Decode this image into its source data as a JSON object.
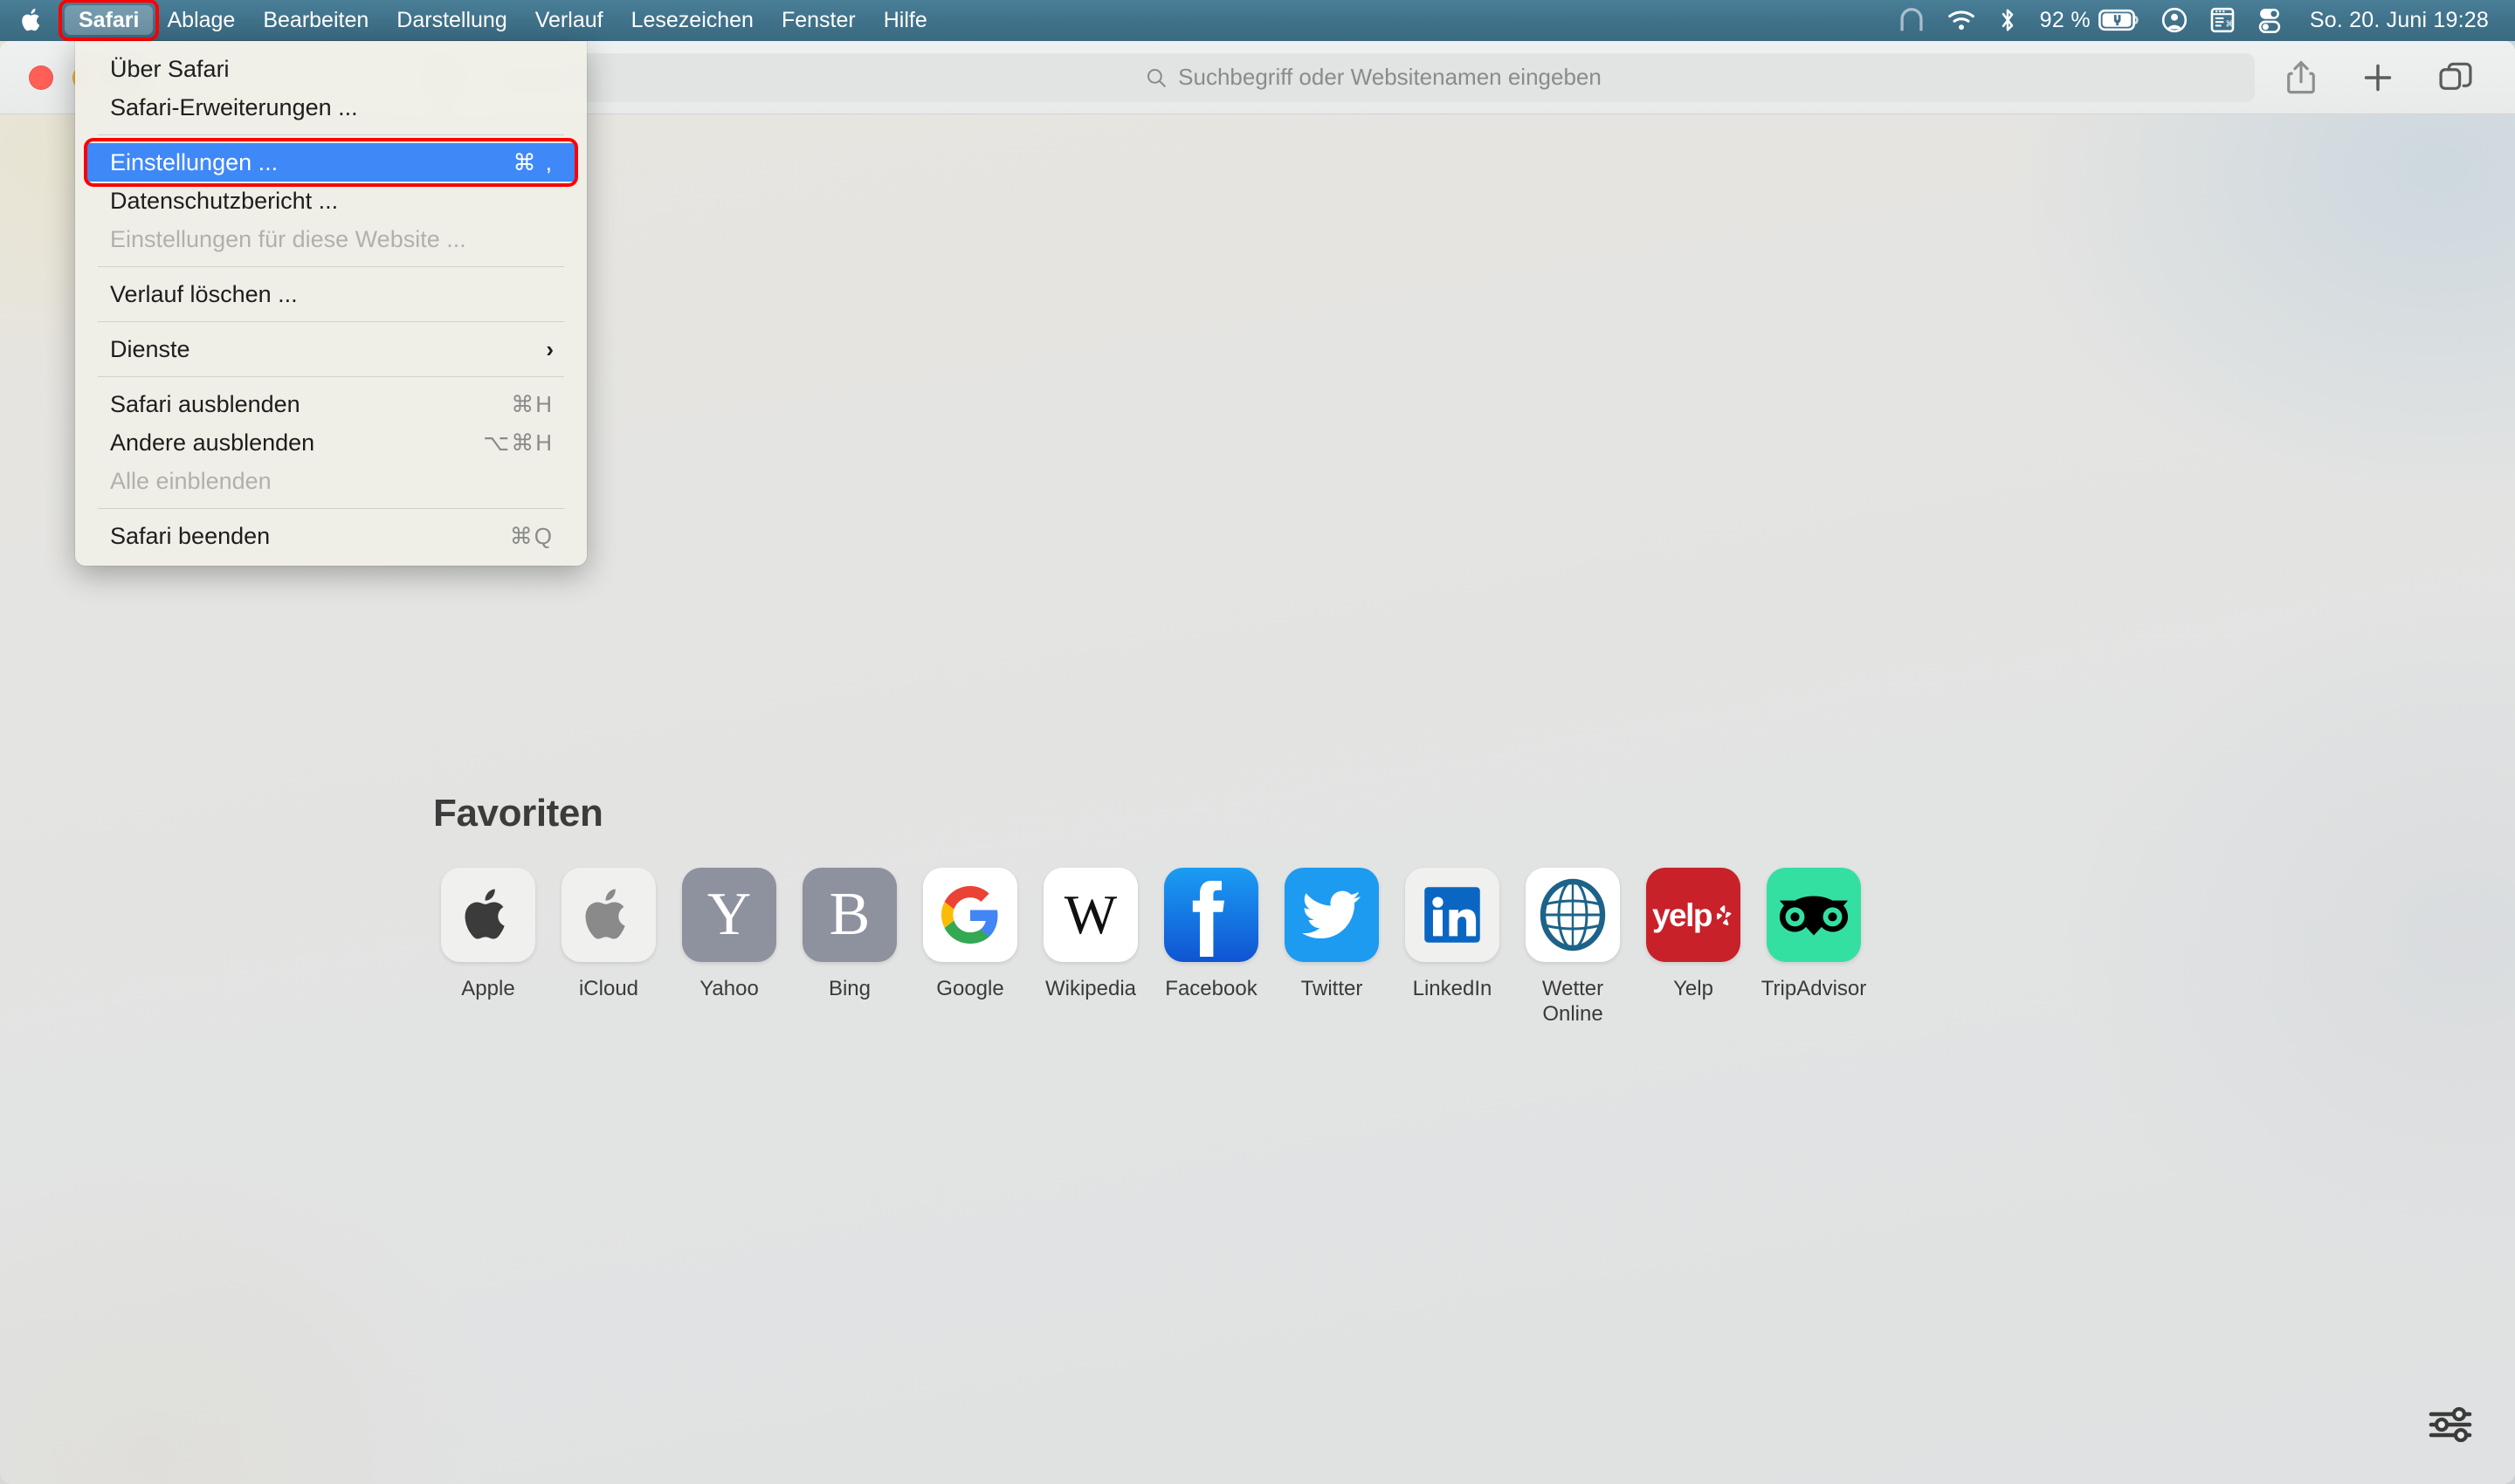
{
  "menubar": {
    "apple_icon": "apple-logo-icon",
    "items": [
      {
        "label": "Safari",
        "active": true
      },
      {
        "label": "Ablage",
        "active": false
      },
      {
        "label": "Bearbeiten",
        "active": false
      },
      {
        "label": "Darstellung",
        "active": false
      },
      {
        "label": "Verlauf",
        "active": false
      },
      {
        "label": "Lesezeichen",
        "active": false
      },
      {
        "label": "Fenster",
        "active": false
      },
      {
        "label": "Hilfe",
        "active": false
      }
    ],
    "status": {
      "vpn_icon": "vpn-tunnel-icon",
      "wifi_icon": "wifi-icon",
      "bluetooth_icon": "bluetooth-icon",
      "battery_percent": "92 %",
      "battery_icon": "battery-charging-icon",
      "account_icon": "user-account-icon",
      "input_menu_icon": "keyboard-input-icon",
      "control_center_icon": "control-center-icon",
      "clock": "So. 20. Juni  19:28"
    },
    "background_color": "#3f7189",
    "text_color": "#ffffff"
  },
  "annotation": {
    "color": "#ff0000",
    "targets": [
      "safari-menu-title",
      "einstellungen-menu-item"
    ]
  },
  "safari_menu": {
    "items": [
      {
        "label": "Über Safari",
        "shortcut": "",
        "state": "normal",
        "type": "item"
      },
      {
        "label": "Safari-Erweiterungen ...",
        "shortcut": "",
        "state": "normal",
        "type": "item"
      },
      {
        "type": "separator"
      },
      {
        "label": "Einstellungen ...",
        "shortcut": "⌘ ,",
        "state": "selected",
        "type": "item"
      },
      {
        "label": "Datenschutzbericht ...",
        "shortcut": "",
        "state": "normal",
        "type": "item"
      },
      {
        "label": "Einstellungen für diese Website ...",
        "shortcut": "",
        "state": "disabled",
        "type": "item"
      },
      {
        "type": "separator"
      },
      {
        "label": "Verlauf löschen ...",
        "shortcut": "",
        "state": "normal",
        "type": "item"
      },
      {
        "type": "separator"
      },
      {
        "label": "Dienste",
        "shortcut": "",
        "state": "normal",
        "type": "submenu"
      },
      {
        "type": "separator"
      },
      {
        "label": "Safari ausblenden",
        "shortcut": "⌘H",
        "state": "normal",
        "type": "item"
      },
      {
        "label": "Andere ausblenden",
        "shortcut": "⌥⌘H",
        "state": "normal",
        "type": "item"
      },
      {
        "label": "Alle einblenden",
        "shortcut": "",
        "state": "disabled",
        "type": "item"
      },
      {
        "type": "separator"
      },
      {
        "label": "Safari beenden",
        "shortcut": "⌘Q",
        "state": "normal",
        "type": "item"
      }
    ]
  },
  "toolbar": {
    "traffic_lights": [
      "close-button",
      "minimize-button",
      "zoom-button"
    ],
    "shield_icon": "privacy-shield-icon",
    "address_placeholder": "Suchbegriff oder Websitenamen eingeben",
    "address_value": "",
    "search_icon": "search-icon",
    "share_icon": "share-icon",
    "new_tab_icon": "plus-icon",
    "tab_overview_icon": "tab-overview-icon"
  },
  "startpage": {
    "favorites_heading": "Favoriten",
    "settings_icon": "sliders-settings-icon",
    "favorites": [
      {
        "label": "Apple",
        "icon": "apple-logo-icon",
        "tile_bg": "#f0f0ef",
        "fg": "#3b3b3b"
      },
      {
        "label": "iCloud",
        "icon": "apple-logo-icon",
        "tile_bg": "#f0f0ef",
        "fg": "#8a8a8a"
      },
      {
        "label": "Yahoo",
        "icon": "letter-y-icon",
        "tile_bg": "#8e919e",
        "fg": "#ffffff"
      },
      {
        "label": "Bing",
        "icon": "letter-b-icon",
        "tile_bg": "#8e919e",
        "fg": "#ffffff"
      },
      {
        "label": "Google",
        "icon": "google-g-icon",
        "tile_bg": "#ffffff",
        "fg": "#4285f4"
      },
      {
        "label": "Wikipedia",
        "icon": "wikipedia-w-icon",
        "tile_bg": "#ffffff",
        "fg": "#1a1a1a"
      },
      {
        "label": "Facebook",
        "icon": "facebook-f-icon",
        "tile_bg": "#1877f2",
        "fg": "#ffffff"
      },
      {
        "label": "Twitter",
        "icon": "twitter-bird-icon",
        "tile_bg": "#1d9bf0",
        "fg": "#ffffff"
      },
      {
        "label": "LinkedIn",
        "icon": "linkedin-in-icon",
        "tile_bg": "#f0f0ef",
        "fg": "#0a66c2"
      },
      {
        "label": "Wetter\nOnline",
        "icon": "globe-grid-icon",
        "tile_bg": "#ffffff",
        "fg": "#1d6389"
      },
      {
        "label": "Yelp",
        "icon": "yelp-logo-icon",
        "tile_bg": "#c8212a",
        "fg": "#ffffff"
      },
      {
        "label": "TripAdvisor",
        "icon": "tripadvisor-owl-icon",
        "tile_bg": "#34e0a1",
        "fg": "#000000"
      }
    ]
  }
}
